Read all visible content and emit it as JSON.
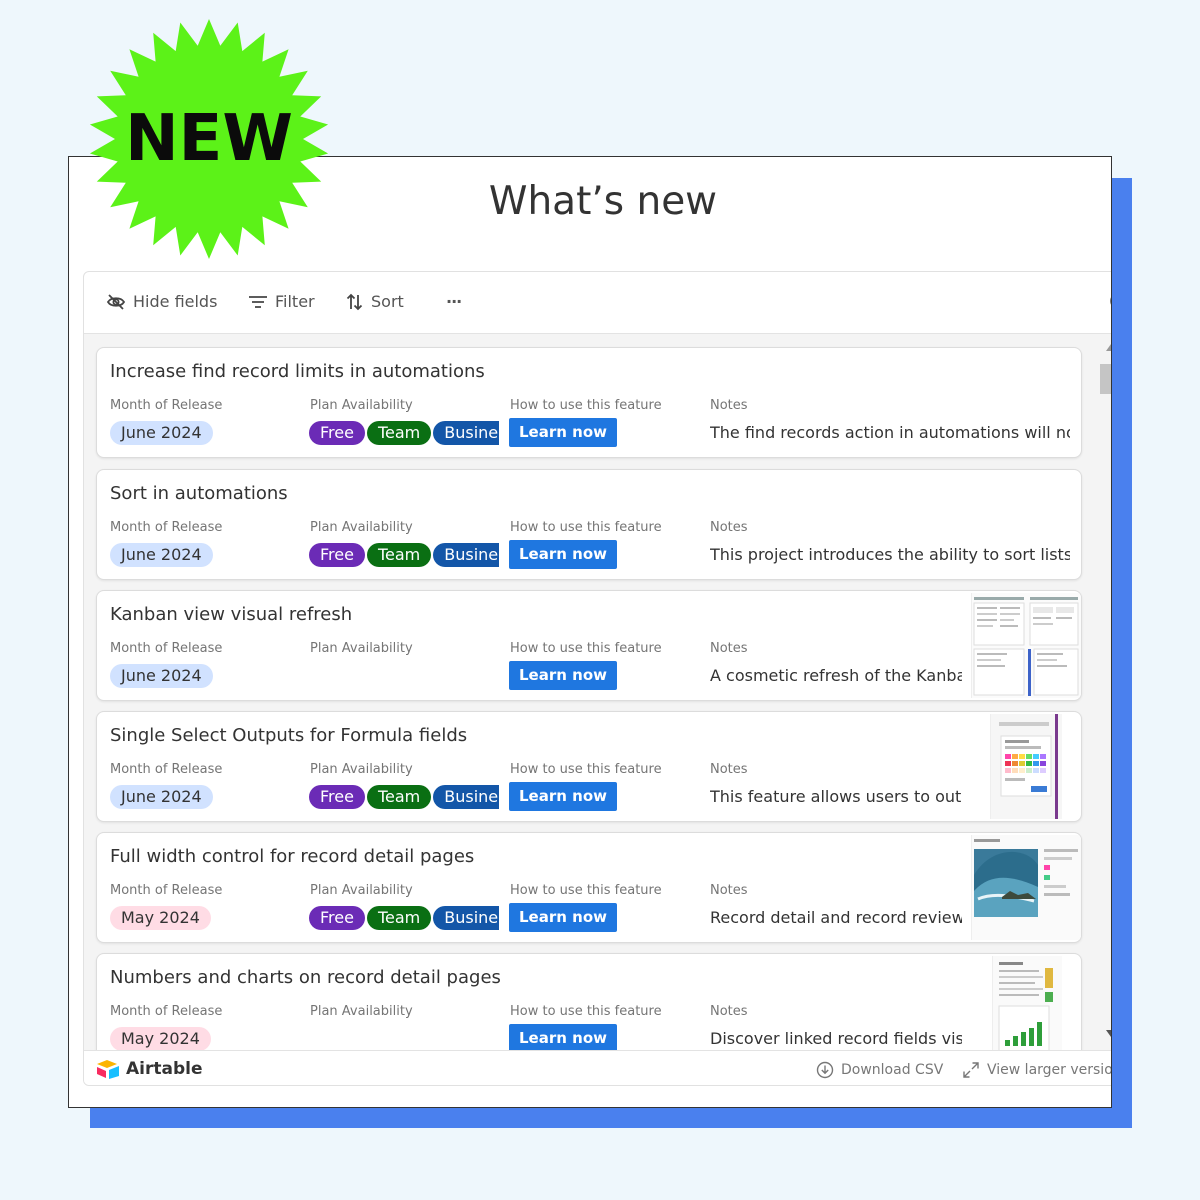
{
  "badge": {
    "label": "NEW",
    "color": "#5cf218"
  },
  "page": {
    "title": "What’s new",
    "accent_shadow": "#4a80ee"
  },
  "toolbar": {
    "hide_fields": "Hide fields",
    "filter": "Filter",
    "sort": "Sort",
    "more": "···"
  },
  "field_labels": {
    "month": "Month of Release",
    "plan": "Plan Availability",
    "how": "How to use this feature",
    "notes": "Notes"
  },
  "plan_labels": {
    "free": "Free",
    "team": "Team",
    "business": "Busine"
  },
  "records": [
    {
      "title": "Increase find record limits in automations",
      "month": "June 2024",
      "plans_shown": true,
      "learn": "Learn now",
      "notes": "The find records action in automations will now",
      "thumbnail": "none"
    },
    {
      "title": "Sort in automations",
      "month": "June 2024",
      "plans_shown": true,
      "learn": "Learn now",
      "notes": "This project introduces the ability to sort lists o",
      "thumbnail": "none"
    },
    {
      "title": "Kanban view visual refresh",
      "month": "June 2024",
      "plans_shown": false,
      "learn": "Learn now",
      "notes": "A cosmetic refresh of the Kanban",
      "thumbnail": "kanban-screenshot"
    },
    {
      "title": "Single Select Outputs for Formula fields",
      "month": "June 2024",
      "plans_shown": true,
      "learn": "Learn now",
      "notes": "This feature allows users to outpu",
      "thumbnail": "color-picker-screenshot"
    },
    {
      "title": "Full width control for record detail pages",
      "month": "May 2024",
      "plans_shown": true,
      "learn": "Learn now",
      "notes": "Record detail and record review p",
      "thumbnail": "wave-photo-screenshot"
    },
    {
      "title": "Numbers and charts on record detail pages",
      "month": "May 2024",
      "plans_shown": false,
      "learn": "Learn now",
      "notes": "Discover linked record fields visu",
      "thumbnail": "chart-screenshot"
    }
  ],
  "footer": {
    "brand": "Airtable",
    "download": "Download CSV",
    "larger": "View larger version"
  }
}
